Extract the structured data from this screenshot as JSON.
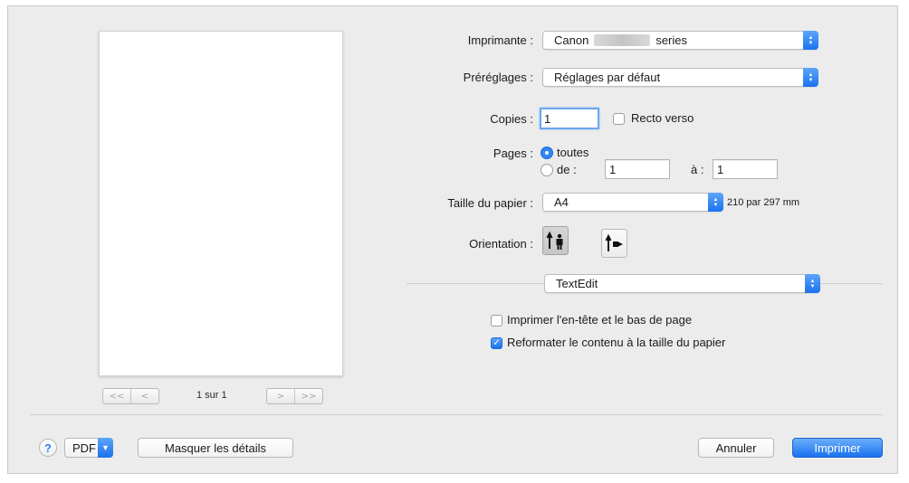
{
  "preview": {
    "page_info": "1 sur 1",
    "first_glyph": "<<",
    "prev_glyph": "<",
    "next_glyph": ">",
    "last_glyph": ">>"
  },
  "printer": {
    "label": "Imprimante :",
    "value_prefix": "Canon",
    "value_suffix": "series"
  },
  "presets": {
    "label": "Préréglages :",
    "value": "Réglages par défaut"
  },
  "copies": {
    "label": "Copies :",
    "value": "1",
    "duplex_label": "Recto verso",
    "duplex_checked": false
  },
  "pages": {
    "label": "Pages :",
    "all_label": "toutes",
    "from_label": "de :",
    "from_value": "1",
    "to_label": "à :",
    "to_value": "1",
    "selected": "all"
  },
  "paper_size": {
    "label": "Taille du papier :",
    "value": "A4",
    "dimensions": "210 par 297 mm"
  },
  "orientation": {
    "label": "Orientation :",
    "selected": "portrait"
  },
  "app_menu": {
    "value": "TextEdit"
  },
  "options": [
    {
      "label": "Imprimer l'en-tête et le bas de page",
      "checked": false
    },
    {
      "label": "Reformater le contenu à la taille du papier",
      "checked": true
    }
  ],
  "footer": {
    "help_glyph": "?",
    "pdf_label": "PDF",
    "hide_details_label": "Masquer les détails",
    "cancel_label": "Annuler",
    "print_label": "Imprimer"
  },
  "colors": {
    "accent": "#1a72ef"
  }
}
